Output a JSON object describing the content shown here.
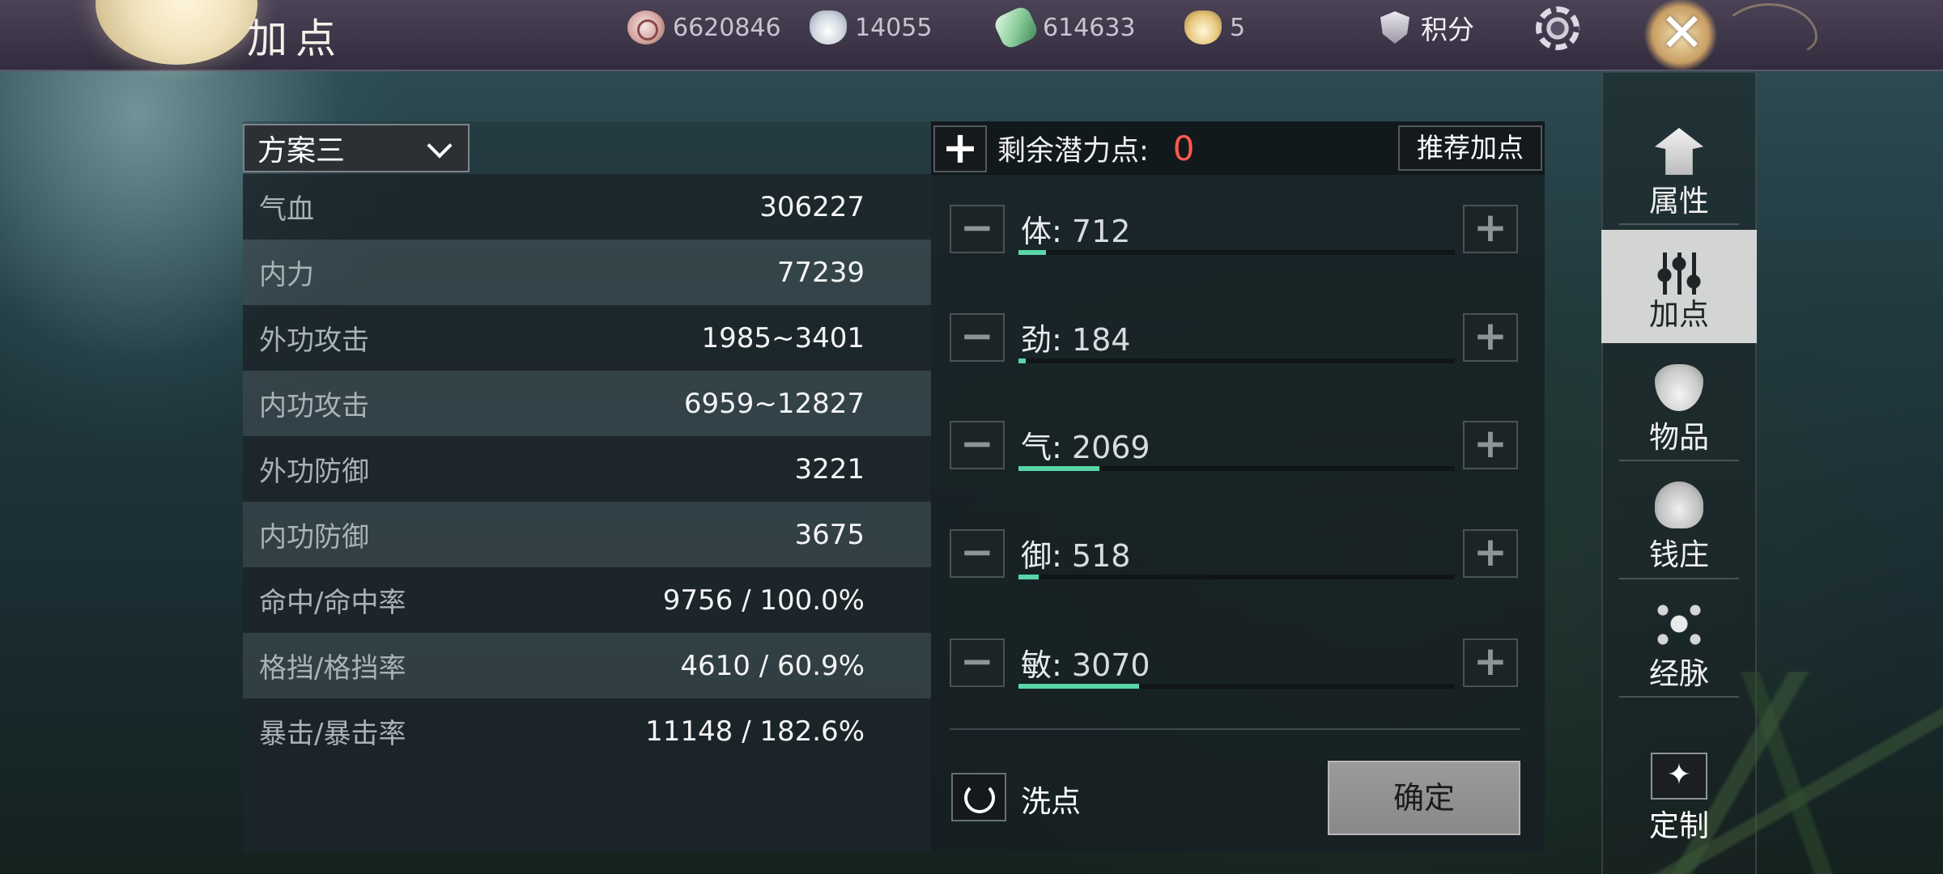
{
  "header": {
    "title": "加点",
    "resources": [
      {
        "icon": "copper-coin-icon",
        "value": "6620846"
      },
      {
        "icon": "silver-ingot-icon",
        "value": "14055"
      },
      {
        "icon": "jade-token-icon",
        "value": "614633"
      },
      {
        "icon": "gold-ingot-icon",
        "value": "5"
      }
    ],
    "score_label": "积分"
  },
  "scheme": {
    "selected": "方案三"
  },
  "stats": [
    {
      "label": "气血",
      "value": "306227"
    },
    {
      "label": "内力",
      "value": "77239"
    },
    {
      "label": "外功攻击",
      "value": "1985~3401"
    },
    {
      "label": "内功攻击",
      "value": "6959~12827"
    },
    {
      "label": "外功防御",
      "value": "3221"
    },
    {
      "label": "内功防御",
      "value": "3675"
    },
    {
      "label": "命中/命中率",
      "value": "9756 / 100.0%"
    },
    {
      "label": "格挡/格挡率",
      "value": "4610 / 60.9%"
    },
    {
      "label": "暴击/暴击率",
      "value": "11148 / 182.6%"
    }
  ],
  "points": {
    "remaining_label": "剩余潜力点:",
    "remaining_value": "0",
    "recommend_label": "推荐加点"
  },
  "attributes": [
    {
      "name": "体",
      "value": "712",
      "fill_fraction": 0.063
    },
    {
      "name": "劲",
      "value": "184",
      "fill_fraction": 0.016
    },
    {
      "name": "气",
      "value": "2069",
      "fill_fraction": 0.186
    },
    {
      "name": "御",
      "value": "518",
      "fill_fraction": 0.046
    },
    {
      "name": "敏",
      "value": "3070",
      "fill_fraction": 0.276
    }
  ],
  "actions": {
    "wash_label": "洗点",
    "confirm_label": "确定"
  },
  "nav": [
    {
      "label": "属性",
      "icon": "hat-icon",
      "active": false
    },
    {
      "label": "加点",
      "icon": "sliders-icon",
      "active": true
    },
    {
      "label": "物品",
      "icon": "bag-icon",
      "active": false
    },
    {
      "label": "钱庄",
      "icon": "bank-icon",
      "active": false
    },
    {
      "label": "经脉",
      "icon": "meridian-icon",
      "active": false
    }
  ],
  "custom_label": "定制",
  "colors": {
    "accent_fill": "#58d6a8",
    "remaining_red": "#ff5a4e",
    "topbar": "#3d3548"
  }
}
